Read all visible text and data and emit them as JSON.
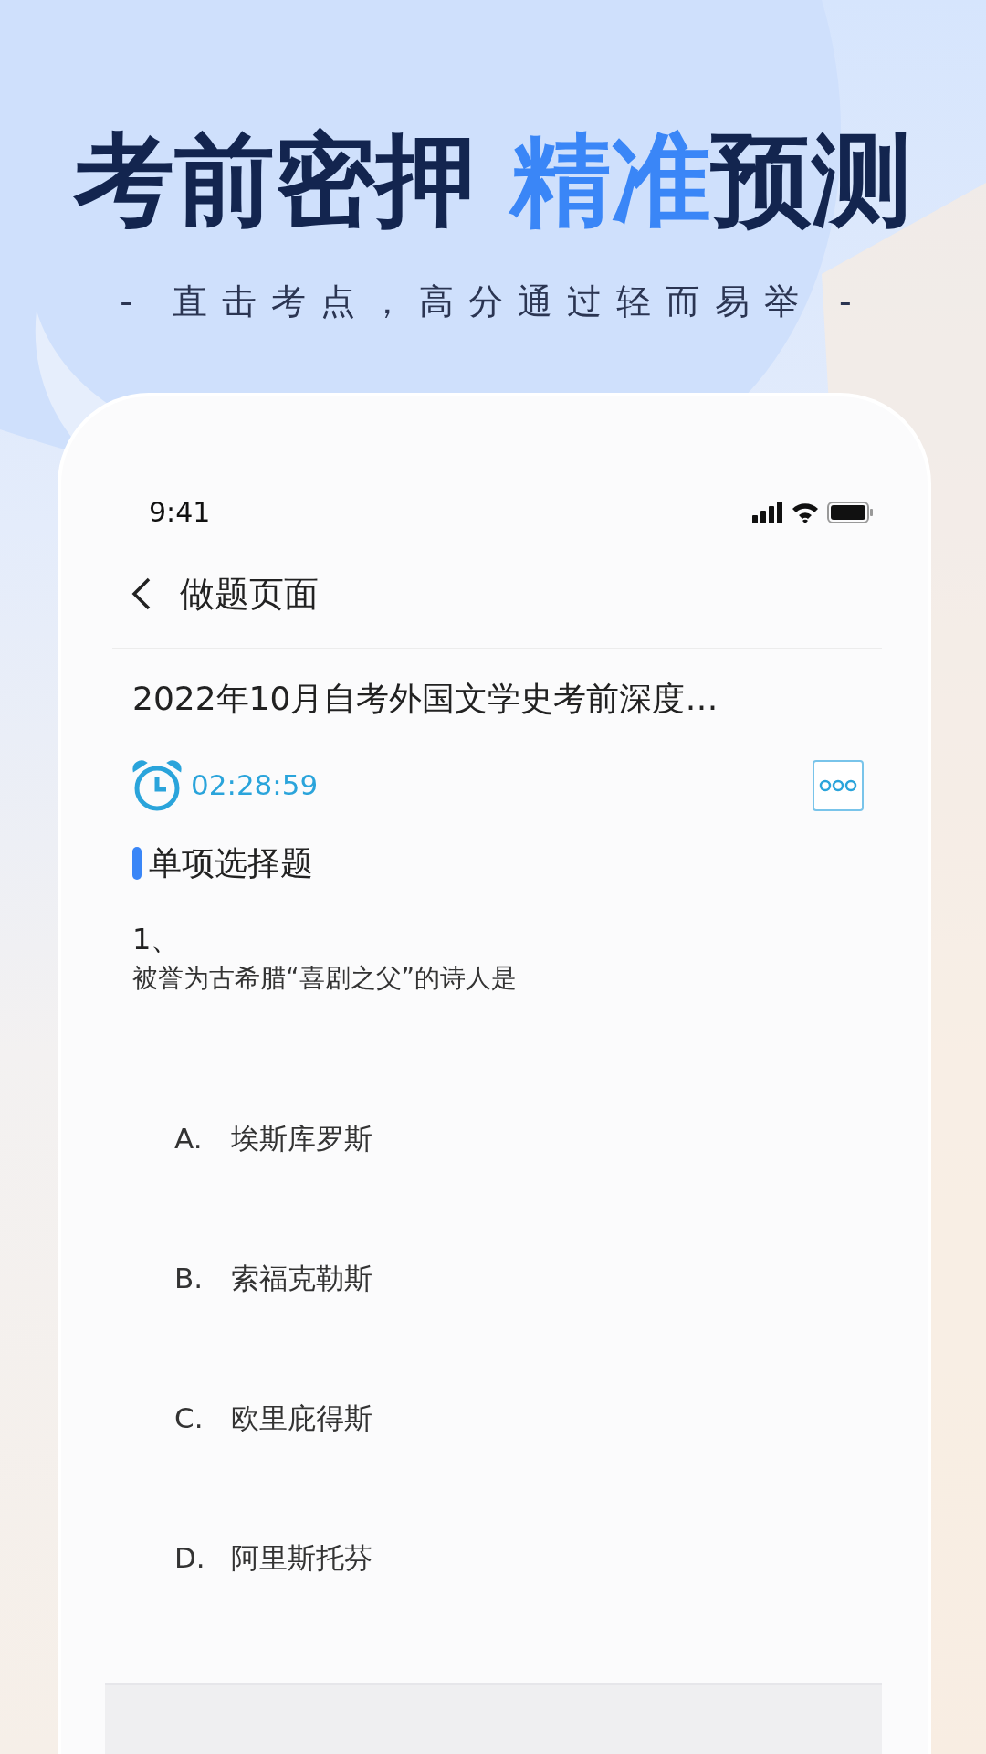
{
  "headline": [
    {
      "text": "考前密押 ",
      "highlight": false
    },
    {
      "text": "精准",
      "highlight": true
    },
    {
      "text": "预测",
      "highlight": false
    }
  ],
  "tagline": "- 直击考点，高分通过轻而易举 -",
  "status_bar": {
    "time": "9:41"
  },
  "nav": {
    "title": "做题页面"
  },
  "exam_title": "2022年10月自考外国文学史考前深度…",
  "timer": "02:28:59",
  "section": "单项选择题",
  "question": {
    "number": "1、",
    "text": "被誉为古希腊“喜剧之父”的诗人是",
    "options": [
      {
        "letter": "A.",
        "text": "埃斯库罗斯"
      },
      {
        "letter": "B.",
        "text": "索福克勒斯"
      },
      {
        "letter": "C.",
        "text": "欧里庇得斯"
      },
      {
        "letter": "D.",
        "text": "阿里斯托芬"
      }
    ]
  }
}
